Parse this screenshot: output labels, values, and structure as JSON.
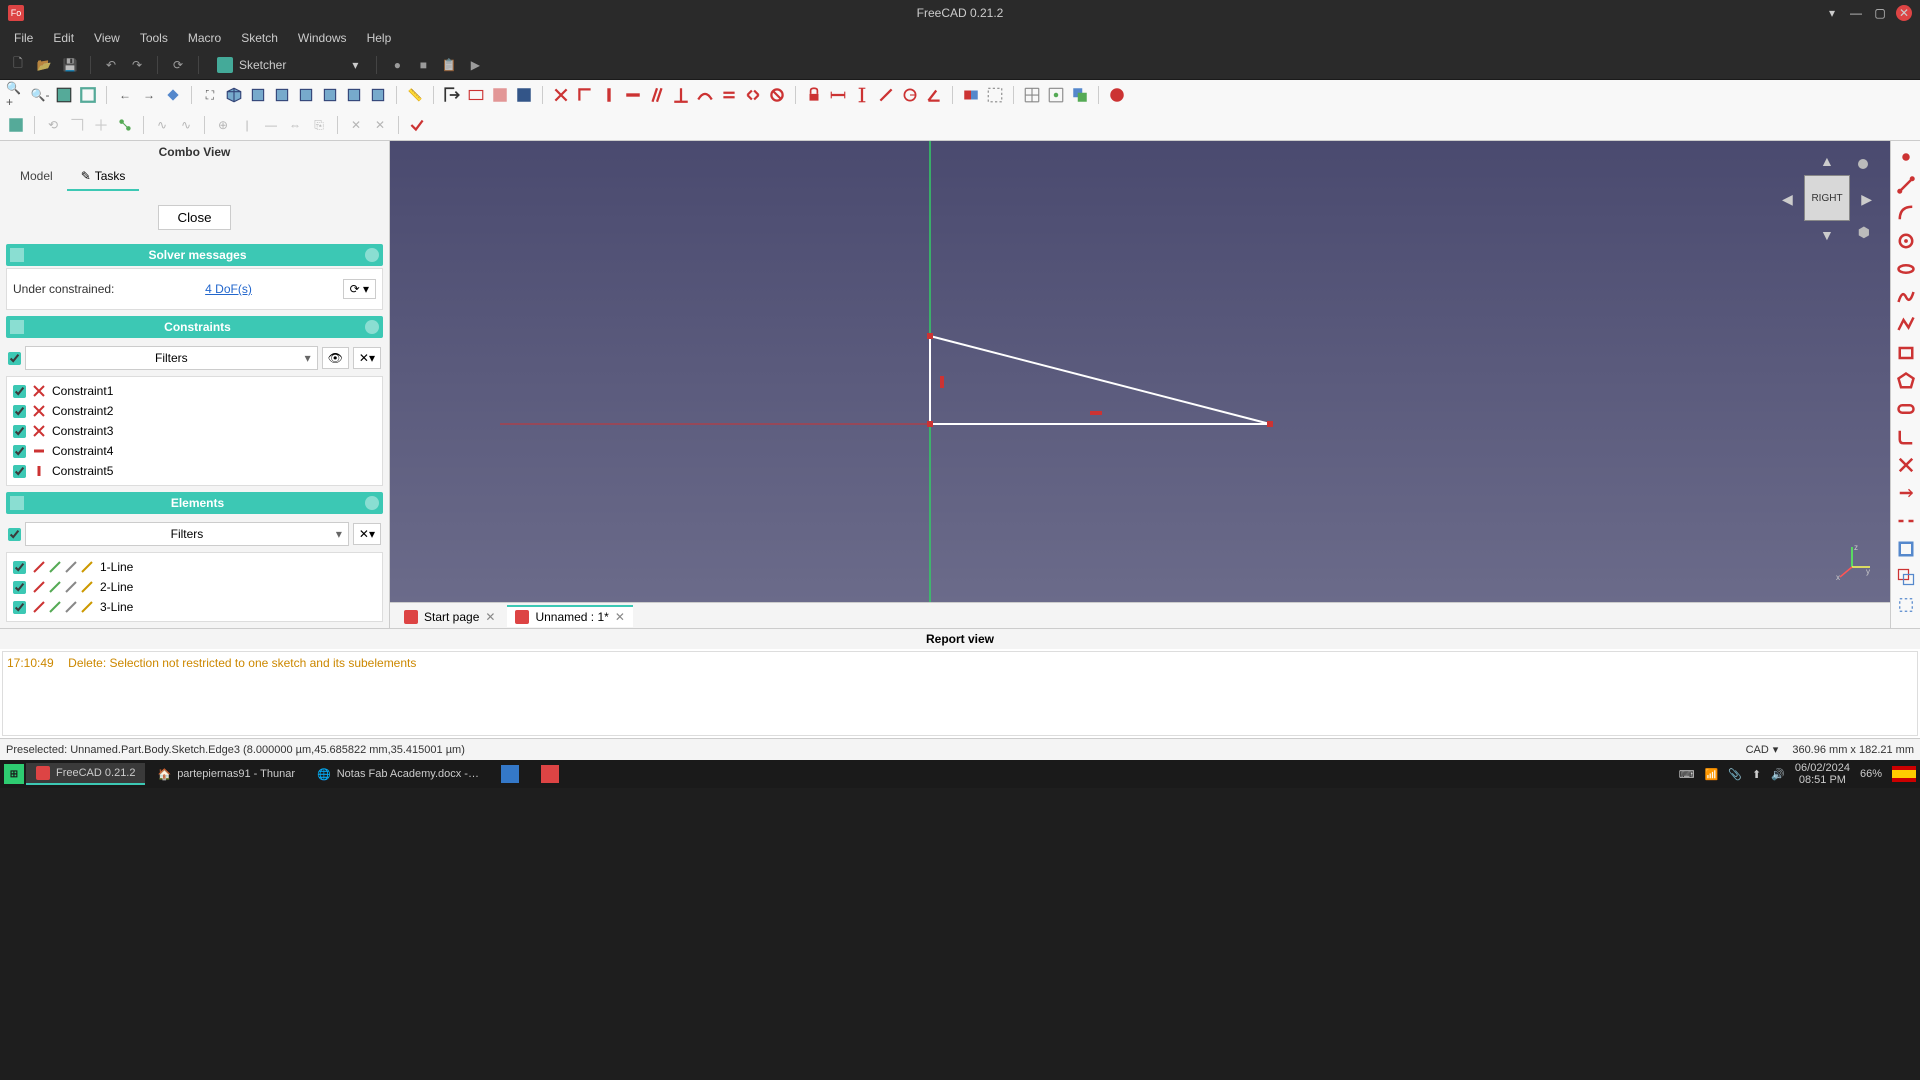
{
  "window": {
    "title": "FreeCAD 0.21.2"
  },
  "menu": [
    "File",
    "Edit",
    "View",
    "Tools",
    "Macro",
    "Sketch",
    "Windows",
    "Help"
  ],
  "workbench": "Sketcher",
  "combo": {
    "title": "Combo View",
    "tabs": {
      "model": "Model",
      "tasks": "Tasks"
    },
    "close": "Close",
    "solver": {
      "header": "Solver messages",
      "label": "Under constrained:",
      "link": "4 DoF(s)"
    },
    "constraints": {
      "header": "Constraints",
      "filters": "Filters",
      "items": [
        "Constraint1",
        "Constraint2",
        "Constraint3",
        "Constraint4",
        "Constraint5"
      ]
    },
    "elements": {
      "header": "Elements",
      "filters": "Filters",
      "items": [
        "1-Line",
        "2-Line",
        "3-Line"
      ]
    }
  },
  "navcube": {
    "face": "RIGHT"
  },
  "doctabs": {
    "start": "Start page",
    "doc": "Unnamed : 1*"
  },
  "report": {
    "title": "Report view",
    "log_time": "17:10:49",
    "log_msg": "Delete: Selection not restricted to one sketch and its subelements"
  },
  "status": {
    "preselect": "Preselected: Unnamed.Part.Body.Sketch.Edge3 (8.000000 µm,45.685822 mm,35.415001 µm)",
    "nav": "CAD",
    "coords": "360.96 mm x 182.21 mm"
  },
  "taskbar": {
    "app1": "FreeCAD 0.21.2",
    "app2": "partepiernas91 - Thunar",
    "app3": "Notas Fab Academy.docx -…",
    "date": "06/02/2024",
    "time": "08:51 PM",
    "battery": "66%"
  }
}
